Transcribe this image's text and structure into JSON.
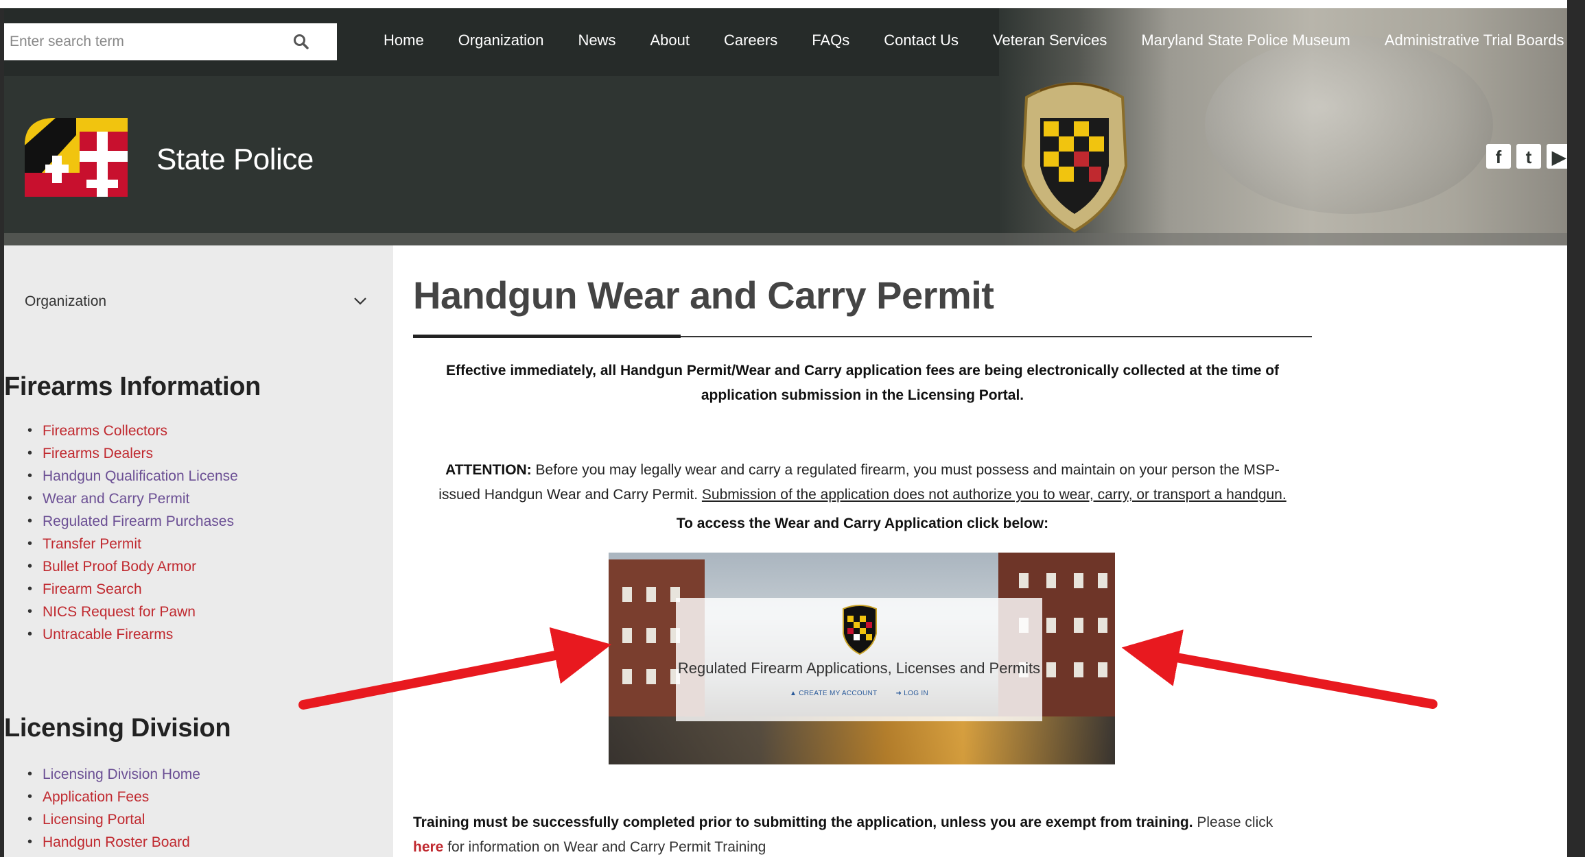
{
  "search": {
    "placeholder": "Enter search term"
  },
  "nav": {
    "items": [
      "Home",
      "Organization",
      "News",
      "About",
      "Careers",
      "FAQs",
      "Contact Us",
      "Veteran Services",
      "Maryland State Police Museum",
      "Administrative Trial Boards"
    ]
  },
  "brand": {
    "name": "State Police"
  },
  "social": {
    "items": [
      "f",
      "t",
      "▶"
    ]
  },
  "sidebar": {
    "dropdown_label": "Organization",
    "firearms_heading": "Firearms Information",
    "firearms_items": [
      {
        "label": "Firearms Collectors",
        "color": "#c0292f"
      },
      {
        "label": "Firearms Dealers",
        "color": "#c0292f"
      },
      {
        "label": "Handgun Qualification License",
        "color": "#6b4f94"
      },
      {
        "label": "Wear and Carry Permit",
        "color": "#6b4f94"
      },
      {
        "label": "Regulated Firearm Purchases",
        "color": "#6b4f94"
      },
      {
        "label": "Transfer Permit",
        "color": "#c0292f"
      },
      {
        "label": "Bullet Proof Body Armor",
        "color": "#c0292f"
      },
      {
        "label": "Firearm Search",
        "color": "#c0292f"
      },
      {
        "label": "NICS Request for Pawn",
        "color": "#c0292f"
      },
      {
        "label": "Untracable Firearms",
        "color": "#c0292f"
      }
    ],
    "licensing_heading": "Licensing Division",
    "licensing_items": [
      {
        "label": "Licensing Division Home",
        "color": "#6b4f94"
      },
      {
        "label": "Application Fees",
        "color": "#c0292f"
      },
      {
        "label": "Licensing Portal",
        "color": "#c0292f"
      },
      {
        "label": "Handgun Roster Board",
        "color": "#c0292f"
      }
    ]
  },
  "main": {
    "title": "Handgun Wear and Carry Permit",
    "notice_line1": "Effective immediately, all Handgun Permit/Wear and Carry application fees are being electronically collected at the time of",
    "notice_line2": "application submission in the Licensing Portal.",
    "attention_label": "ATTENTION:",
    "attention_text1": " Before you may legally wear and carry a regulated firearm, you must possess and maintain on your person the MSP-",
    "attention_text2": "issued Handgun Wear and Carry Permit. ",
    "attention_underlined": "Submission of the application does not authorize you to wear, carry, or transport a handgun.",
    "access_text": "To access the Wear and Carry Application click below:",
    "banner_title": "Regulated Firearm Applications, Licenses and Permits",
    "banner_create": "▲ CREATE MY ACCOUNT",
    "banner_login": "➜ LOG IN",
    "training_bold": "Training must be successfully completed prior to submitting the application, unless you are exempt from training.",
    "training_text": " Please click",
    "training_link": "here",
    "training_text2": " for information on Wear and Carry Permit Training"
  },
  "colors": {
    "link_red": "#c0292f",
    "link_purple": "#6b4f94",
    "arrow_red": "#e8191f",
    "header_dark": "#2f3532"
  }
}
